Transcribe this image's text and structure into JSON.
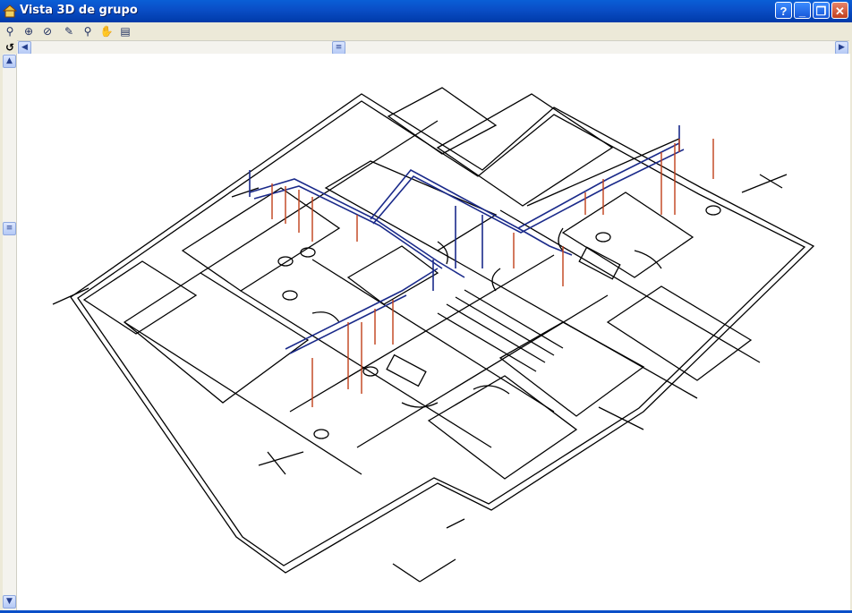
{
  "window": {
    "title": "Vista 3D de grupo",
    "controls": {
      "help": "?",
      "minimize": "_",
      "restore": "❐",
      "close": "✕"
    }
  },
  "toolbar": {
    "tools": [
      {
        "name": "zoom-tool-icon",
        "glyph": "⚲"
      },
      {
        "name": "zoom-window-icon",
        "glyph": "⊕"
      },
      {
        "name": "zoom-previous-icon",
        "glyph": "⊘"
      },
      {
        "name": "draw-tool-icon",
        "glyph": "✎"
      },
      {
        "name": "zoom-extents-icon",
        "glyph": "⚲"
      },
      {
        "name": "pan-hand-icon",
        "glyph": "✋"
      },
      {
        "name": "layers-icon",
        "glyph": "▤"
      }
    ],
    "rotate_glyph": "↺"
  },
  "scrollbars": {
    "left_arrow": "◀",
    "right_arrow": "▶",
    "up_arrow": "▲",
    "down_arrow": "▼",
    "thumb": "≡"
  },
  "colors": {
    "pipe_blue": "#1a2a8a",
    "pipe_red": "#c0401a",
    "walls": "#000000",
    "titlebar": "#0a4fc8"
  }
}
